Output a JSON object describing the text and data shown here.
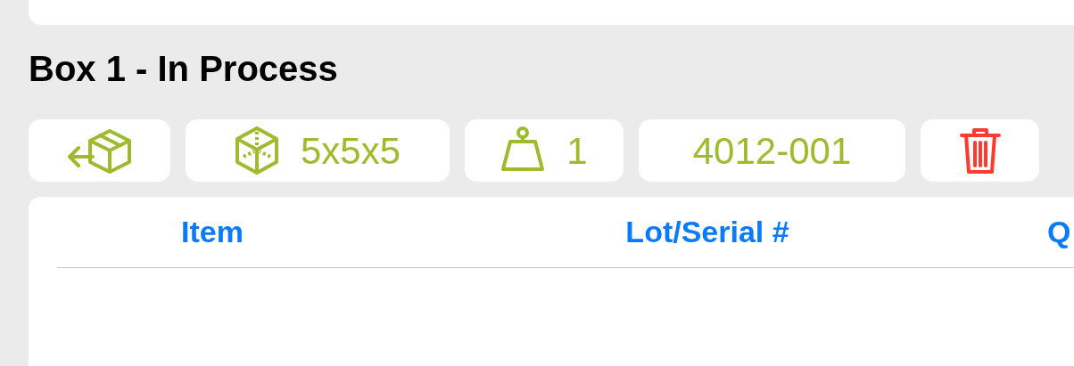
{
  "box_title": "Box 1 - In Process",
  "actions": [
    {
      "kind": "unpack"
    },
    {
      "kind": "dimensions",
      "label": "5x5x5"
    },
    {
      "kind": "weight",
      "label": "1"
    },
    {
      "kind": "code",
      "label": "4012-001"
    },
    {
      "kind": "delete"
    }
  ],
  "table": {
    "columns": [
      "Item",
      "Lot/Serial #",
      "Q"
    ]
  }
}
